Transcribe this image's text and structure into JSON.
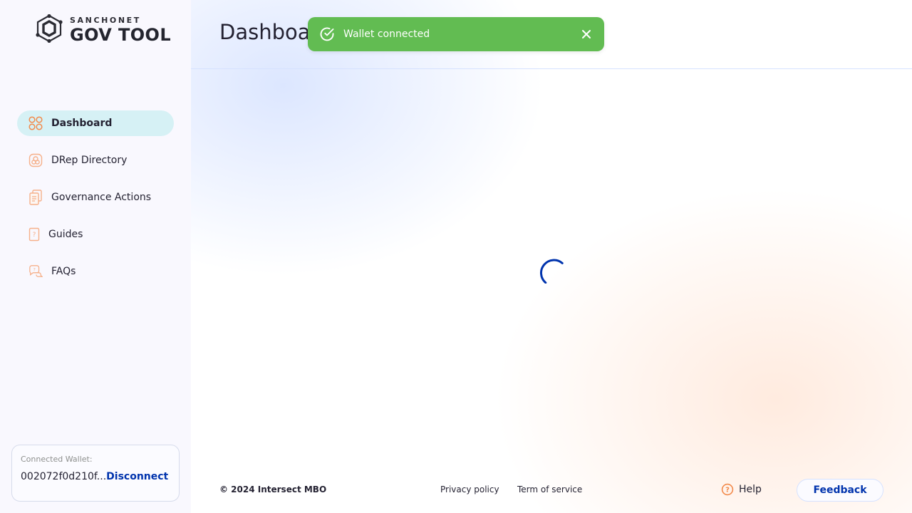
{
  "brand": {
    "top_line": "SANCHONET",
    "bottom_line": "GOV TOOL",
    "accent": "#0033ad",
    "orange": "#f28a4b"
  },
  "sidebar": {
    "items": [
      {
        "label": "Dashboard",
        "icon": "dashboard-icon",
        "active": true
      },
      {
        "label": "DRep Directory",
        "icon": "drep-directory-icon",
        "active": false
      },
      {
        "label": "Governance Actions",
        "icon": "governance-actions-icon",
        "active": false
      },
      {
        "label": "Guides",
        "icon": "guides-icon",
        "active": false
      },
      {
        "label": "FAQs",
        "icon": "faqs-icon",
        "active": false
      }
    ],
    "wallet": {
      "label": "Connected Wallet:",
      "address": "002072f0d210f...",
      "disconnect_label": "Disconnect"
    }
  },
  "header": {
    "title": "Dashboard"
  },
  "toast": {
    "message": "Wallet connected",
    "color": "#62bc52"
  },
  "footer": {
    "copyright": "© 2024 Intersect MBO",
    "privacy": "Privacy policy",
    "terms": "Term of service",
    "help": "Help",
    "feedback": "Feedback"
  }
}
